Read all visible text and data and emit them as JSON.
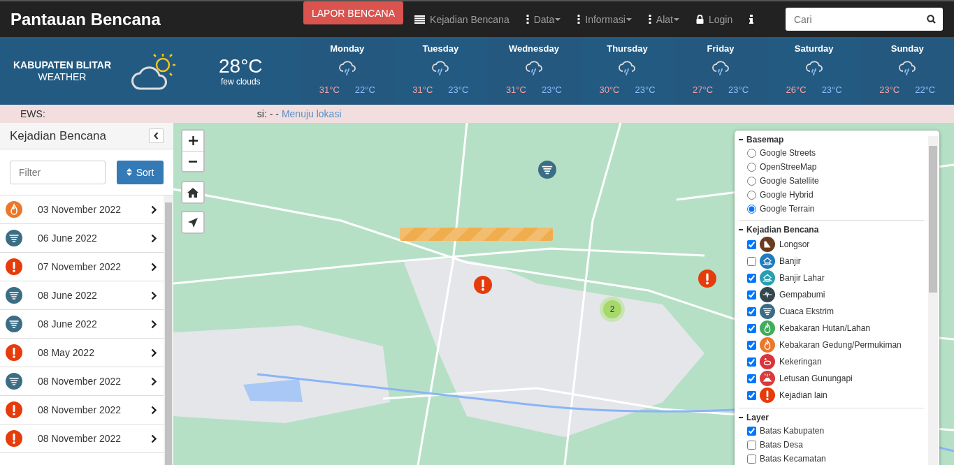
{
  "navbar": {
    "brand": "Pantauan Bencana",
    "report_button": "LAPOR BENCANA",
    "menu": [
      {
        "label": "Kejadian Bencana",
        "kind": "list",
        "dropdown": false
      },
      {
        "label": "Data",
        "kind": "dots",
        "dropdown": true
      },
      {
        "label": "Informasi",
        "kind": "dots",
        "dropdown": true
      },
      {
        "label": "Alat",
        "kind": "dots",
        "dropdown": true
      },
      {
        "label": "Login",
        "kind": "lock",
        "dropdown": false
      }
    ],
    "search": {
      "placeholder": "Cari"
    }
  },
  "weather": {
    "location": "KABUPATEN BLITAR",
    "subtitle": "WEATHER",
    "temperature": "28°C",
    "condition": "few clouds",
    "days": [
      {
        "day": "Monday",
        "high": "31°C",
        "low": "22°C"
      },
      {
        "day": "Tuesday",
        "high": "31°C",
        "low": "23°C"
      },
      {
        "day": "Wednesday",
        "high": "31°C",
        "low": "23°C"
      },
      {
        "day": "Thursday",
        "high": "30°C",
        "low": "23°C"
      },
      {
        "day": "Friday",
        "high": "27°C",
        "low": "23°C"
      },
      {
        "day": "Saturday",
        "high": "26°C",
        "low": "23°C"
      },
      {
        "day": "Sunday",
        "high": "23°C",
        "low": "22°C"
      }
    ]
  },
  "ews": {
    "label": "EWS:",
    "ticker": "si: - -",
    "link": "Menuju lokasi"
  },
  "sidebar": {
    "title": "Kejadian Bencana",
    "filter": {
      "placeholder": "Filter"
    },
    "sort_button": "Sort",
    "items": [
      {
        "kind": "kebakaran-gedung",
        "date": "03 November 2022"
      },
      {
        "kind": "cuaca-ekstrim",
        "date": "06 June 2022"
      },
      {
        "kind": "kejadian-lain",
        "date": "07 November 2022"
      },
      {
        "kind": "cuaca-ekstrim",
        "date": "08 June 2022"
      },
      {
        "kind": "cuaca-ekstrim",
        "date": "08 June 2022"
      },
      {
        "kind": "kejadian-lain",
        "date": "08 May 2022"
      },
      {
        "kind": "cuaca-ekstrim",
        "date": "08 November 2022"
      },
      {
        "kind": "kejadian-lain",
        "date": "08 November 2022"
      },
      {
        "kind": "kejadian-lain",
        "date": "08 November 2022"
      }
    ]
  },
  "map": {
    "markers": [
      {
        "kind": "cuaca-ekstrim"
      },
      {
        "kind": "kejadian-lain"
      },
      {
        "kind": "kejadian-lain"
      },
      {
        "kind": "cluster",
        "count": "2"
      }
    ]
  },
  "layer_panel": {
    "sections": [
      {
        "title": "Basemap",
        "kind": "radio",
        "items": [
          {
            "label": "Google Streets",
            "selected": false
          },
          {
            "label": "OpenStreeMap",
            "selected": false
          },
          {
            "label": "Google Satellite",
            "selected": false
          },
          {
            "label": "Google Hybrid",
            "selected": false
          },
          {
            "label": "Google Terrain",
            "selected": true
          }
        ]
      },
      {
        "title": "Kejadian Bencana",
        "kind": "checkbox-icon",
        "items": [
          {
            "label": "Longsor",
            "checked": true,
            "kind": "longsor"
          },
          {
            "label": "Banjir",
            "checked": false,
            "kind": "banjir"
          },
          {
            "label": "Banjir Lahar",
            "checked": true,
            "kind": "banjir-lahar"
          },
          {
            "label": "Gempabumi",
            "checked": true,
            "kind": "gempabumi"
          },
          {
            "label": "Cuaca Ekstrim",
            "checked": true,
            "kind": "cuaca-ekstrim"
          },
          {
            "label": "Kebakaran Hutan/Lahan",
            "checked": true,
            "kind": "kebakaran-hutan"
          },
          {
            "label": "Kebakaran Gedung/Permukiman",
            "checked": true,
            "kind": "kebakaran-gedung"
          },
          {
            "label": "Kekeringan",
            "checked": true,
            "kind": "kekeringan"
          },
          {
            "label": "Letusan Gunungapi",
            "checked": true,
            "kind": "letusan"
          },
          {
            "label": "Kejadian lain",
            "checked": true,
            "kind": "kejadian-lain"
          }
        ]
      },
      {
        "title": "Layer",
        "kind": "checkbox",
        "items": [
          {
            "label": "Batas Kabupaten",
            "checked": true
          },
          {
            "label": "Batas Desa",
            "checked": false
          },
          {
            "label": "Batas Kecamatan",
            "checked": false
          }
        ]
      }
    ]
  }
}
